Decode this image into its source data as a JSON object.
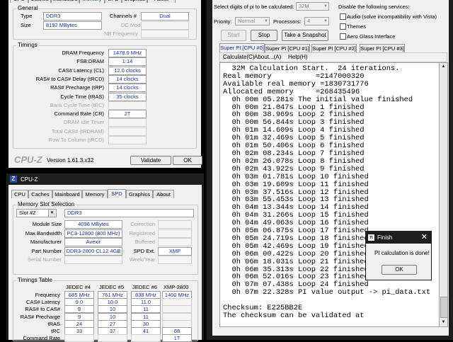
{
  "cpuz_top": {
    "tabs": [
      "CPU",
      "Caches",
      "Mainboard",
      "Memory",
      "SPD",
      "Graphics",
      "About"
    ],
    "general": {
      "title": "General",
      "type_label": "Type",
      "type_value": "DDR3",
      "size_label": "Size",
      "size_value": "8192 MBytes",
      "channels_label": "Channels #",
      "channels_value": "Dual",
      "dc_mode_label": "DC Mode",
      "nb_freq_label": "NB Frequency"
    },
    "timings": {
      "title": "Timings",
      "rows": [
        {
          "label": "DRAM Frequency",
          "value": "1478.0 MHz",
          "enabled": true
        },
        {
          "label": "FSB:DRAM",
          "value": "1:14",
          "enabled": true
        },
        {
          "label": "CAS# Latency (CL)",
          "value": "12.0 clocks",
          "enabled": true
        },
        {
          "label": "RAS# to CAS# Delay (tRCD)",
          "value": "14 clocks",
          "enabled": true
        },
        {
          "label": "RAS# Precharge (tRP)",
          "value": "14 clocks",
          "enabled": true
        },
        {
          "label": "Cycle Time (tRAS)",
          "value": "35 clocks",
          "enabled": true
        },
        {
          "label": "Bank Cycle Time (tRC)",
          "value": "",
          "enabled": false
        },
        {
          "label": "Command Rate (CR)",
          "value": "2T",
          "enabled": true
        },
        {
          "label": "DRAM Idle Timer",
          "value": "",
          "enabled": false
        },
        {
          "label": "Total CAS# (tRDRAM)",
          "value": "",
          "enabled": false
        },
        {
          "label": "Row To Column (tRCD)",
          "value": "",
          "enabled": false
        }
      ]
    },
    "footer": {
      "brand": "CPU-Z",
      "version": "Version 1.61.3.x32",
      "validate": "Validate",
      "ok": "OK"
    }
  },
  "cpuz_bottom": {
    "title": "CPU-Z",
    "icon_letter": "Z",
    "tabs": [
      "CPU",
      "Caches",
      "Mainboard",
      "Memory",
      "SPD",
      "Graphics",
      "About"
    ],
    "selected_tab": "SPD",
    "slot_group": "Memory Slot Selection",
    "slot_value": "Slot #2",
    "slot_type": "DDR3",
    "rows": [
      {
        "label": "Module Size",
        "value": "4096 MBytes",
        "r_label": "Correction",
        "r_value": ""
      },
      {
        "label": "Max Bandwidth",
        "value": "PC3-12800 (800 MHz)",
        "r_label": "Registered",
        "r_value": ""
      },
      {
        "label": "Manufacturer",
        "value": "Avexir",
        "r_label": "Buffered",
        "r_value": ""
      },
      {
        "label": "Part Number",
        "value": "DDR3-2800 CL12 4GB",
        "r_label": "SPD Ext.",
        "r_value": "XMP"
      },
      {
        "label": "Serial Number",
        "value": "",
        "r_label": "Week/Year",
        "r_value": ""
      }
    ],
    "timings_title": "Timings Table",
    "timings_headers": [
      "JEDEC #4",
      "JEDEC #5",
      "JEDEC #6",
      "XMP-2800"
    ],
    "timings_rows": [
      {
        "label": "Frequency",
        "values": [
          "685 MHz",
          "761 MHz",
          "838 MHz",
          "1400 MHz"
        ]
      },
      {
        "label": "CAS# Latency",
        "values": [
          "9.0",
          "10.0",
          "11.0",
          ""
        ]
      },
      {
        "label": "RAS# to CAS#",
        "values": [
          "9",
          "10",
          "11",
          ""
        ]
      },
      {
        "label": "RAS# Precharge",
        "values": [
          "9",
          "10",
          "11",
          ""
        ]
      },
      {
        "label": "tRAS",
        "values": [
          "24",
          "27",
          "30",
          ""
        ]
      },
      {
        "label": "tRC",
        "values": [
          "33",
          "37",
          "41",
          "68"
        ]
      },
      {
        "label": "Command Rate",
        "values": [
          "",
          "",
          "",
          "1T"
        ]
      }
    ]
  },
  "superpi": {
    "digits_label": "Select digits of pi to be calculated:",
    "digits_value": "32M",
    "priority_label": "Priority:",
    "priority_value": "Normal",
    "processors_label": "Processors:",
    "processors_value": "4",
    "disable_label": "Disable the following services:",
    "checkboxes": [
      "Audio (solve incompatibility with Vista)",
      "Themes",
      "Aero Glass Interface"
    ],
    "buttons": {
      "start": "Start",
      "stop": "Stop",
      "snapshot": "Take a Snapshot"
    },
    "tabs": [
      "Super PI [CPU #0]",
      "Super PI [CPU #1]",
      "Super PI [CPU #2]",
      "Super PI [CPU #3]"
    ],
    "menu": [
      "Calculate(C)",
      "About...(A)",
      "Help(H)"
    ],
    "output_lines": [
      "  32M Calculation Start.  24 iterations.",
      "Real memory          =2147000320",
      "Available real memory =1830731776",
      "Allocated memory     =268435496",
      "  0h 00m 05.281s The initial value finished",
      "  0h 00m 21.047s Loop 1 finished",
      "  0h 00m 38.969s Loop 2 finished",
      "  0h 00m 56.844s Loop 3 finished",
      "  0h 01m 14.609s Loop 4 finished",
      "  0h 01m 32.469s Loop 5 finished",
      "  0h 01m 50.406s Loop 6 finished",
      "  0h 02m 08.234s Loop 7 finished",
      "  0h 02m 26.078s Loop 8 finished",
      "  0h 02m 43.922s Loop 9 finished",
      "  0h 03m 01.781s Loop 10 finished",
      "  0h 03m 19.609s Loop 11 finished",
      "  0h 03m 37.516s Loop 12 finished",
      "  0h 03m 55.453s Loop 13 finished",
      "  0h 04m 13.344s Loop 14 finished",
      "  0h 04m 31.266s Loop 15 finished",
      "  0h 04m 49.063s Loop 16 finished",
      "  0h 05m 06.875s Loop 17 finished",
      "  0h 05m 24.719s Loop 18 finished",
      "  0h 05m 42.469s Loop 19 finished",
      "  0h 06m 00.422s Loop 20 finished",
      "  0h 06m 18.031s Loop 21 finished",
      "  0h 06m 35.313s Loop 22 finished",
      "  0h 06m 52.016s Loop 23 finished",
      "  0h 07m 07.438s Loop 24 finished",
      "  0h 07m 22.328s PI value output -> pi_data.txt",
      "",
      "Checksum: E225BB2E",
      "The checksum can be validated at"
    ]
  },
  "finish_dialog": {
    "title": "Finish",
    "message": "PI calculation is done!",
    "ok": "OK",
    "close": "✕"
  }
}
